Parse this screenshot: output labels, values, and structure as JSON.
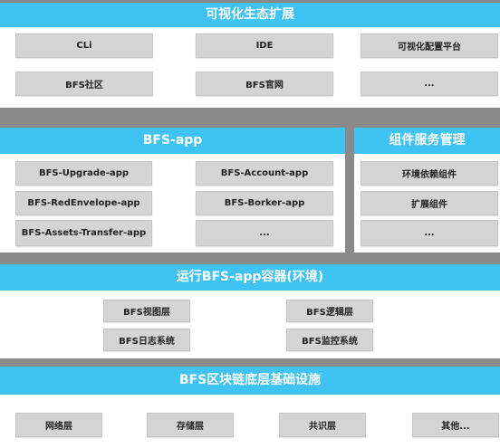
{
  "ecosystem": {
    "title": "可视化生态扩展",
    "items": [
      "CLi",
      "IDE",
      "可视化配置平台",
      "BFS社区",
      "BFS官网",
      "..."
    ]
  },
  "app": {
    "title": "BFS-app",
    "items": [
      "BFS-Upgrade-app",
      "BFS-Account-app",
      "BFS-RedEnvelope-app",
      "BFS-Borker-app",
      "BFS-Assets-Transfer-app",
      "..."
    ]
  },
  "component_service": {
    "title": "组件服务管理",
    "items": [
      "环境依赖组件",
      "扩展组件",
      "..."
    ]
  },
  "runtime": {
    "title": "运行BFS-app容器(环境)",
    "items": [
      "BFS视图层",
      "BFS逻辑层",
      "BFS日志系统",
      "BFS监控系统"
    ]
  },
  "infrastructure": {
    "title": "BFS区块链底层基础设施",
    "items": [
      "网络层",
      "存储层",
      "共识层",
      "其他..."
    ]
  },
  "colors": {
    "band": "#3fc3f2",
    "divider": "#8a8a8a",
    "box": "#d4d4d4",
    "panel": "#ffffff"
  }
}
